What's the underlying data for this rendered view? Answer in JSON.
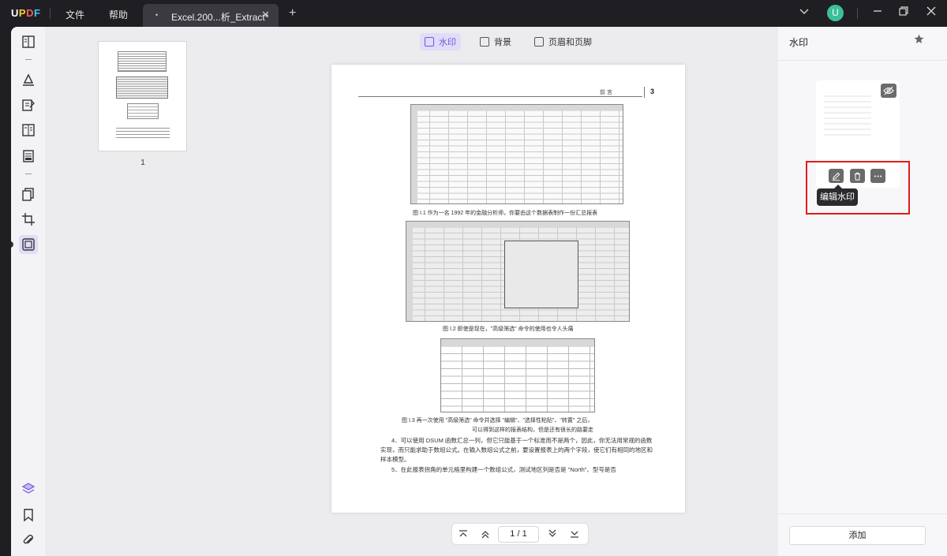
{
  "titlebar": {
    "logo": {
      "u": "U",
      "p": "P",
      "d": "D",
      "f": "F"
    },
    "menu": [
      "文件",
      "帮助"
    ],
    "tab": {
      "title": "Excel.200...析_Extract*",
      "modified_dot": "•",
      "close": "✕"
    },
    "new_tab": "+",
    "avatar_letter": "U"
  },
  "thumbnails": {
    "page_label": "1"
  },
  "main_toolbar": {
    "watermark": "水印",
    "background": "背景",
    "header_footer": "页眉和页脚"
  },
  "document_page": {
    "header_label": "前   言",
    "page_number": "3",
    "caption_1": "图 I.1   作为一名 1992 年的金融分析师，你要由这个数据表制作一份汇总报表",
    "caption_2": "图 I.2   即使是现在，\"高级筛选\" 命令的使用也令人头痛",
    "caption_3_line1": "图 I.3   再一次使用 \"高级筛选\" 命令并选择 \"编辑\"、\"选择性粘贴\"、\"转置\" 之后，",
    "caption_3_line2": "可以得到这样的报表结构，但是还有很长的路要走",
    "para_4": "4．可以使用 DSUM 函数汇总一列，但它只能基于一个标准而不是两个，因此，你无法用常规的函数实现，而只能求助于数组公式。在输入数组公式之前，要设置报表上的两个字段，使它们有相同的地区和样本模型。",
    "para_5": "5．在此报表拐角的单元格里构建一个数组公式，测试地区列是否是 \"North\"、型号是否"
  },
  "pager": {
    "current": "1",
    "separator": "/",
    "total": "1"
  },
  "right_panel": {
    "title": "水印",
    "tooltip": "编辑水印",
    "add_button": "添加"
  },
  "colors": {
    "accent": "#7356e0",
    "highlight_box": "#e11b1b",
    "titlebar_bg": "#1f1f23"
  }
}
